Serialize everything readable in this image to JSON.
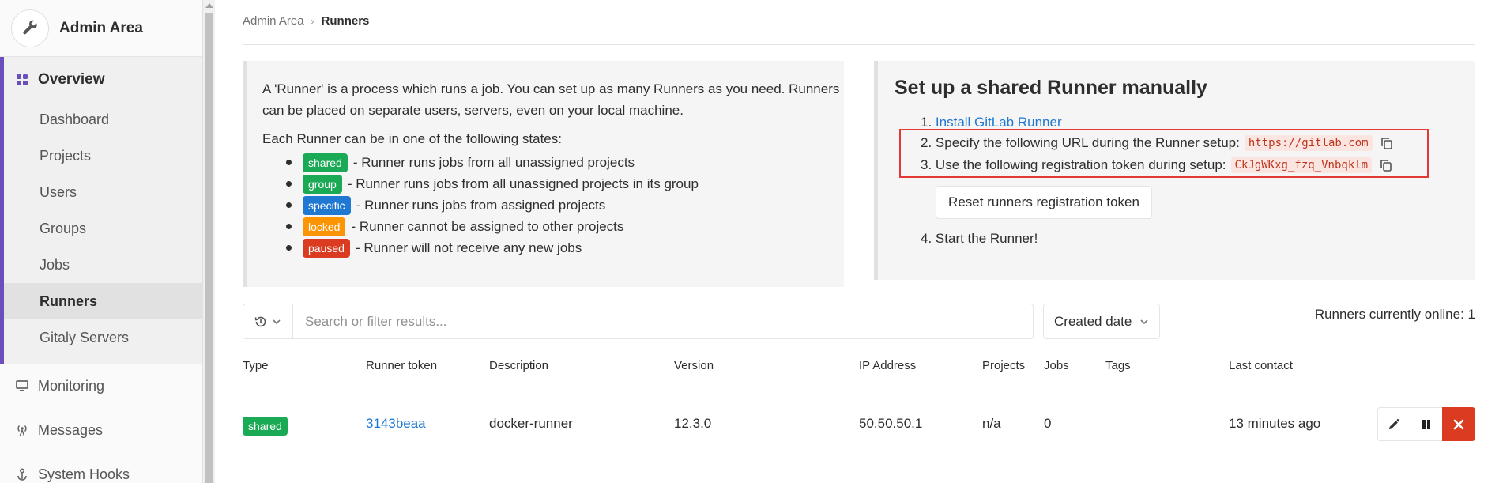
{
  "sidebar": {
    "title": "Admin Area",
    "overview_label": "Overview",
    "sub_items": [
      "Dashboard",
      "Projects",
      "Users",
      "Groups",
      "Jobs",
      "Runners",
      "Gitaly Servers"
    ],
    "active_sub": "Runners",
    "items": [
      "Monitoring",
      "Messages",
      "System Hooks"
    ]
  },
  "breadcrumb": {
    "parent": "Admin Area",
    "current": "Runners"
  },
  "info": {
    "intro": "A 'Runner' is a process which runs a job. You can set up as many Runners as you need. Runners can be placed on separate users, servers, even on your local machine.",
    "states_intro": "Each Runner can be in one of the following states:",
    "states": [
      {
        "badge": "shared",
        "color": "#1aaa55",
        "text": "- Runner runs jobs from all unassigned projects"
      },
      {
        "badge": "group",
        "color": "#1aaa55",
        "text": "- Runner runs jobs from all unassigned projects in its group"
      },
      {
        "badge": "specific",
        "color": "#1f78d1",
        "text": "- Runner runs jobs from assigned projects"
      },
      {
        "badge": "locked",
        "color": "#fc9403",
        "text": "- Runner cannot be assigned to other projects"
      },
      {
        "badge": "paused",
        "color": "#db3b21",
        "text": "- Runner will not receive any new jobs"
      }
    ]
  },
  "setup": {
    "title": "Set up a shared Runner manually",
    "step1_num": "1.",
    "step1_link": "Install GitLab Runner",
    "step2_num": "2.",
    "step2_text": "Specify the following URL during the Runner setup:",
    "step2_code": "https://gitlab.com",
    "step3_num": "3.",
    "step3_text": "Use the following registration token during setup:",
    "step3_code": "CkJgWKxg_fzq_Vnbqklm",
    "reset_button": "Reset runners registration token",
    "step4_num": "4.",
    "step4_text": "Start the Runner!"
  },
  "filter": {
    "search_placeholder": "Search or filter results...",
    "sort_label": "Created date",
    "online_text": "Runners currently online: 1"
  },
  "table": {
    "headers": [
      "Type",
      "Runner token",
      "Description",
      "Version",
      "IP Address",
      "Projects",
      "Jobs",
      "Tags",
      "Last contact"
    ],
    "rows": [
      {
        "type": "shared",
        "token": "3143beaa",
        "description": "docker-runner",
        "version": "12.3.0",
        "ip": "50.50.50.1",
        "projects": "n/a",
        "jobs": "0",
        "tags": "",
        "last_contact": "13 minutes ago"
      }
    ]
  },
  "colors": {
    "accent": "#6b4fbb",
    "link": "#1f78d1",
    "highlight_outline": "#e53935",
    "delete": "#db3b21"
  }
}
